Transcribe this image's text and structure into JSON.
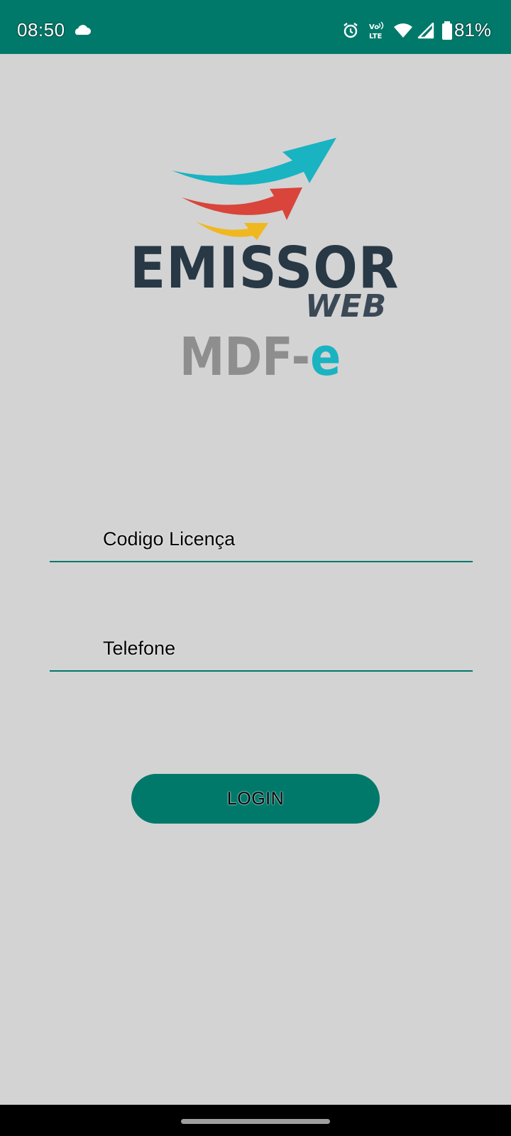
{
  "status_bar": {
    "time": "08:50",
    "battery": "81%",
    "icons": [
      "cloud-icon",
      "alarm-icon",
      "volte-icon",
      "wifi-icon",
      "signal-icon",
      "battery-icon"
    ],
    "volte_label_top": "Vo",
    "volte_label_bottom": "LTE"
  },
  "logo": {
    "brand": "EMISSOR",
    "sub_brand": "WEB",
    "product_prefix": "MDF-",
    "product_suffix": "e",
    "arrow_colors": [
      "#19b3c2",
      "#d9443b",
      "#f0b820"
    ]
  },
  "form": {
    "license_placeholder": "Codigo Licença",
    "license_value": "",
    "phone_placeholder": "Telefone",
    "phone_value": "",
    "login_label": "LOGIN"
  },
  "colors": {
    "primary": "#00796b",
    "background": "#d3d3d3"
  }
}
